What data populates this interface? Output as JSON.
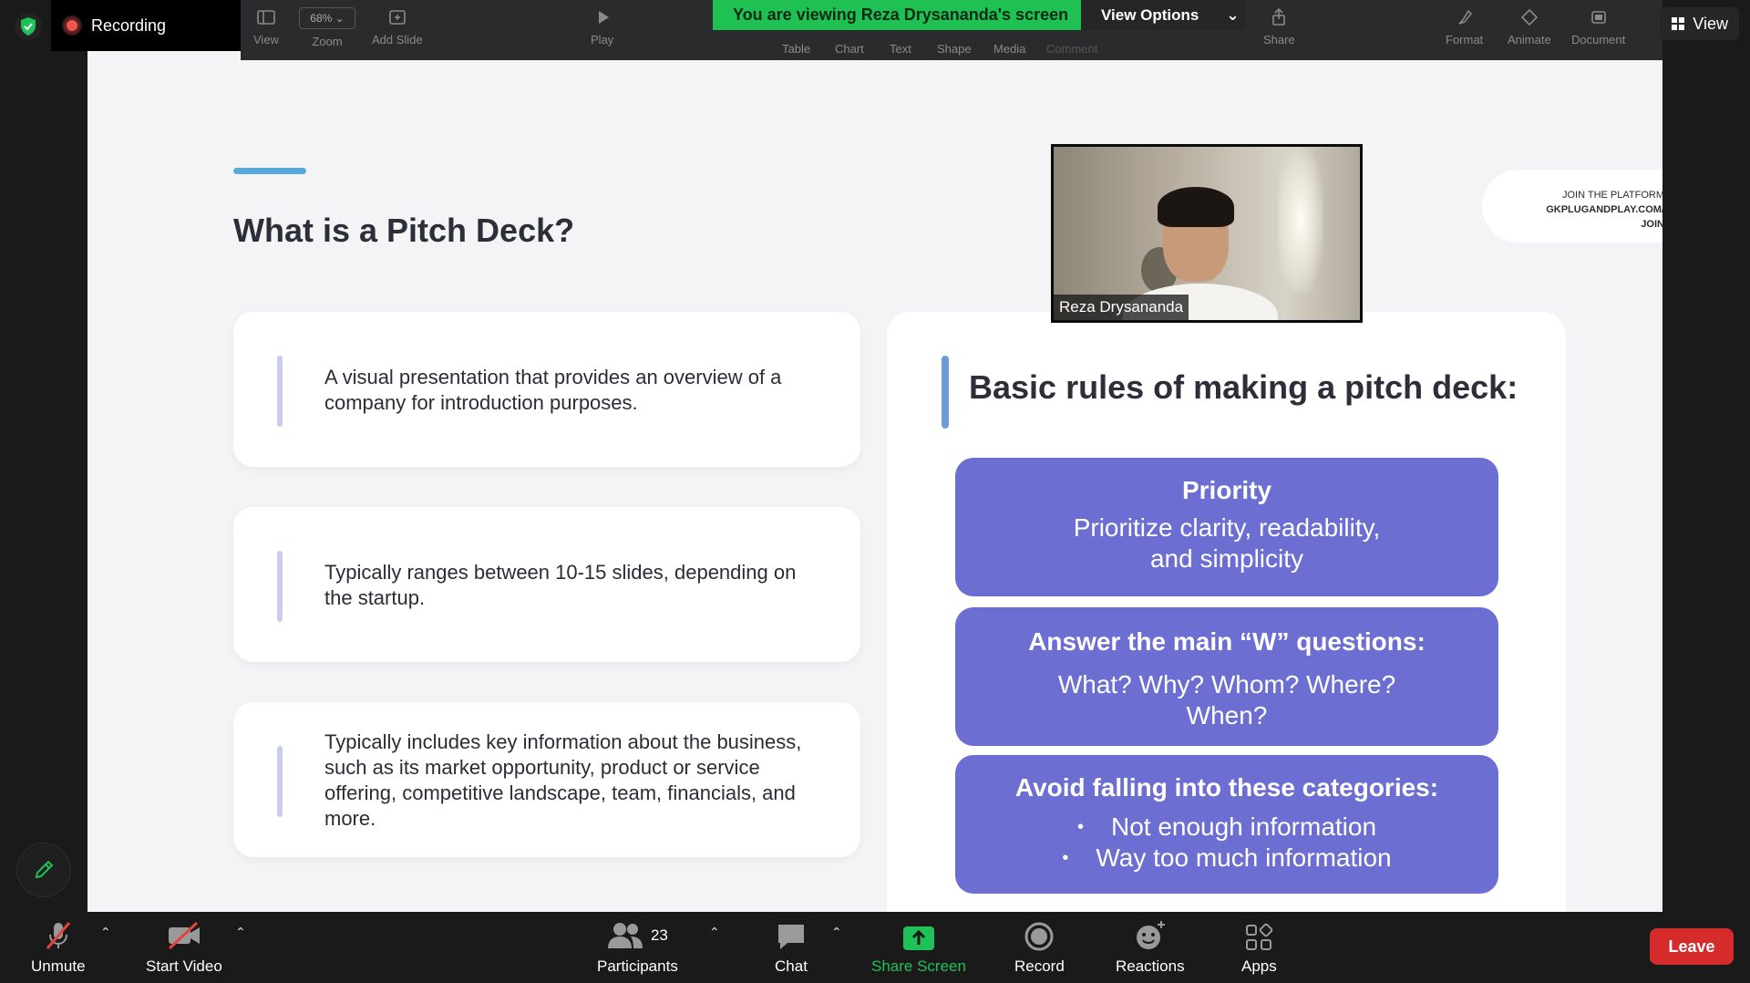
{
  "status": {
    "recording_label": "Recording",
    "view_label": "View"
  },
  "share_banner": {
    "viewing_text": "You are viewing Reza Drysananda's screen",
    "view_options_label": "View Options"
  },
  "keynote_toolbar": {
    "view": "View",
    "zoom": "Zoom",
    "zoom_value": "68%",
    "add_slide": "Add Slide",
    "play": "Play",
    "table": "Table",
    "chart": "Chart",
    "text": "Text",
    "shape": "Shape",
    "media": "Media",
    "comment": "Comment",
    "share": "Share",
    "format": "Format",
    "animate": "Animate",
    "document": "Document"
  },
  "slide": {
    "title": "What is a Pitch Deck?",
    "cards": [
      "A visual presentation that provides an overview of a company for introduction purposes.",
      "Typically ranges between 10-15 slides, depending on the startup.",
      "Typically includes key information about the business, such as its market opportunity, product or service offering, competitive landscape, team, financials, and more."
    ],
    "rules_title": "Basic rules of making a pitch deck:",
    "rules": {
      "priority_head": "Priority",
      "priority_body_1": "Prioritize clarity, readability,",
      "priority_body_2": "and simplicity",
      "w_head": "Answer the main “W” questions:",
      "w_body_1": "What? Why? Whom? Where?",
      "w_body_2": "When?",
      "avoid_head": "Avoid falling into these categories:",
      "avoid_1": "Not enough information",
      "avoid_2": "Way too much information"
    },
    "join_1": "JOIN THE PLATFORM",
    "join_2": "GKPLUGANDPLAY.COM/",
    "join_3": "JOIN"
  },
  "presenter": {
    "name": "Reza Drysananda"
  },
  "toolbar": {
    "unmute": "Unmute",
    "start_video": "Start Video",
    "participants": "Participants",
    "participant_count": "23",
    "chat": "Chat",
    "share_screen": "Share Screen",
    "record": "Record",
    "reactions": "Reactions",
    "apps": "Apps",
    "leave": "Leave"
  },
  "colors": {
    "accent_green": "#1fc153",
    "rule_purple": "#6c6ed1",
    "leave_red": "#d52b2b"
  }
}
